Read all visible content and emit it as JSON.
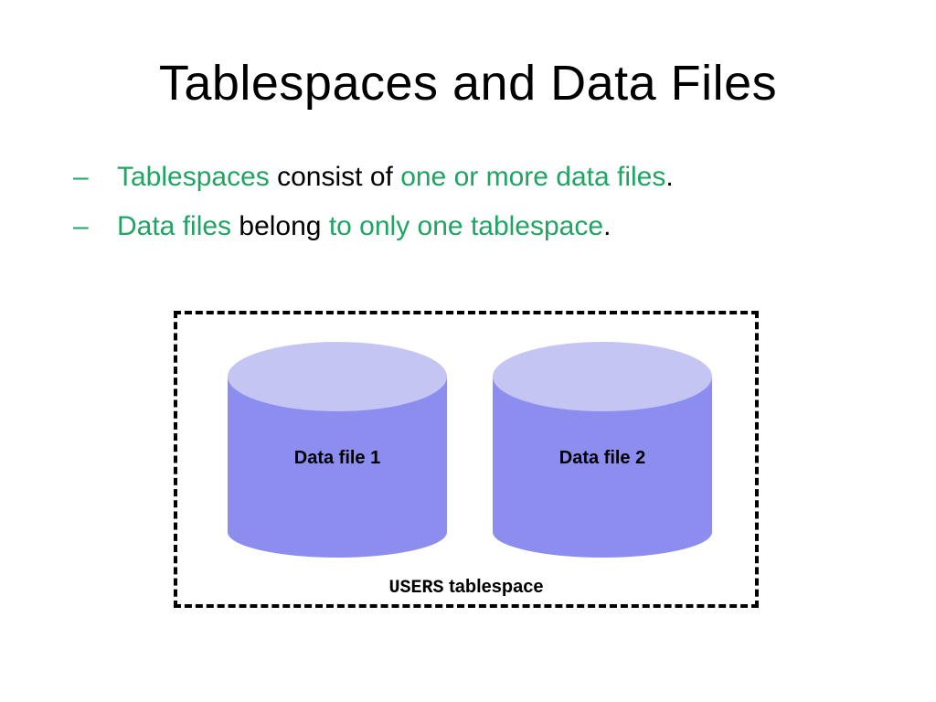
{
  "title": "Tablespaces and Data Files",
  "bullet1": {
    "p1": "Tablespaces",
    "p2": " consist of ",
    "p3": "one or more data files",
    "p4": "."
  },
  "bullet2": {
    "p1": "Data files",
    "p2": " belong ",
    "p3": "to only one tablespace",
    "p4": "."
  },
  "diagram": {
    "cyl1": "Data file 1",
    "cyl2": "Data file 2",
    "ts_name": "USERS",
    "ts_word": " tablespace"
  }
}
